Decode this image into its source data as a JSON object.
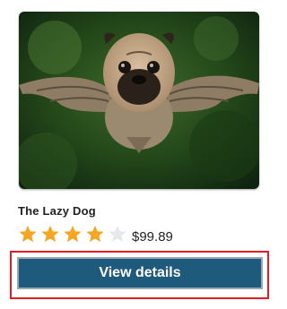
{
  "product": {
    "image_alt_icon": "pug-bird-photo",
    "title": "The Lazy Dog",
    "rating": 4,
    "rating_max": 5,
    "price": "$99.89",
    "button_label": "View details"
  },
  "colors": {
    "star_filled": "#f5a623",
    "star_empty": "#e6e9ec",
    "button_bg": "#1e5a7c",
    "highlight": "#e31b23"
  }
}
